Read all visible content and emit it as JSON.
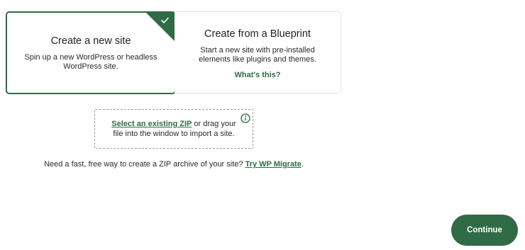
{
  "cards": {
    "new_site": {
      "title": "Create a new site",
      "description": "Spin up a new WordPress or headless WordPress site.",
      "selected": true
    },
    "blueprint": {
      "title": "Create from a Blueprint",
      "description": "Start a new site with pre-installed elements like plugins and themes.",
      "link": "What's this?"
    }
  },
  "import": {
    "link": "Select an existing ZIP",
    "text_after_link": " or drag your",
    "text_line2": "file into the window to import a site."
  },
  "note": {
    "text": "Need a fast, free way to create a ZIP archive of your site? ",
    "link": "Try WP Migrate",
    "suffix": "."
  },
  "buttons": {
    "continue": "Continue"
  },
  "colors": {
    "accent": "#2f6b45",
    "border": "#e4e4e4"
  },
  "icons": {
    "selected": "checkmark-icon",
    "info": "info-icon"
  }
}
